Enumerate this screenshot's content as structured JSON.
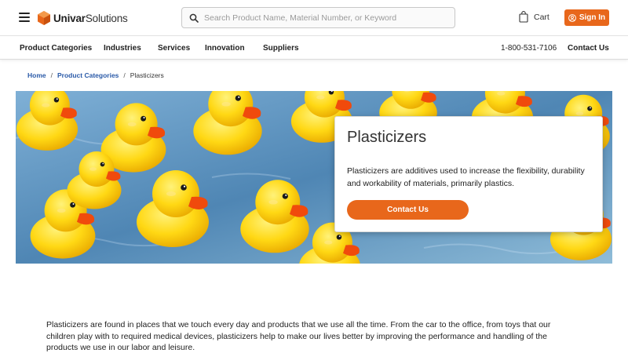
{
  "header": {
    "logo_bold": "Univar",
    "logo_light": "Solutions",
    "search_placeholder": "Search Product Name, Material Number, or Keyword",
    "cart_label": "Cart",
    "signin_label": "Sign In"
  },
  "nav": {
    "items": [
      {
        "label": "Product Categories"
      },
      {
        "label": "Industries"
      },
      {
        "label": "Services"
      },
      {
        "label": "Innovation"
      },
      {
        "label": "Suppliers"
      }
    ],
    "phone": "1-800-531-7106",
    "contact_label": "Contact Us"
  },
  "breadcrumb": {
    "home": "Home",
    "category": "Product Categories",
    "current": "Plasticizers",
    "separator": "/"
  },
  "hero": {
    "title": "Plasticizers",
    "description": "Plasticizers are additives used to increase the flexibility, durability and workability of materials, primarily plastics.",
    "button_label": "Contact Us"
  },
  "intro": {
    "text": "Plasticizers are found in places that we touch every day and products that we use all the time.  From the car to the office, from toys that our children play with to required medical devices, plasticizers help to make our lives better by improving the performance and handling of the products we use in our labor and leisure."
  },
  "colors": {
    "brand_orange": "#e8671b",
    "link_blue": "#2a5aa8"
  },
  "icons": {
    "menu": "hamburger-icon",
    "logo": "univar-logo-icon",
    "search": "search-icon",
    "cart": "shopping-bag-icon",
    "user": "user-icon"
  }
}
